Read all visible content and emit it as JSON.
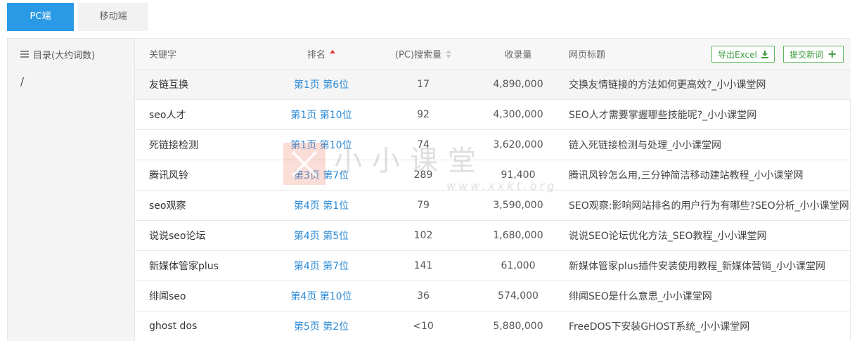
{
  "tabs": [
    {
      "label": "PC端",
      "active": true
    },
    {
      "label": "移动端",
      "active": false
    }
  ],
  "sidebar": {
    "title": "目录(大约词数)",
    "path": "/"
  },
  "table": {
    "headers": {
      "keyword": "关键字",
      "rank": "排名",
      "search_volume": "(PC)搜索量",
      "indexed": "收录量",
      "page_title": "网页标题"
    },
    "rank_sort": "ascending",
    "export_label": "导出Excel",
    "submit_label": "提交新词",
    "rows": [
      {
        "keyword": "友链互换",
        "rank": "第1页 第6位",
        "search": "17",
        "indexed": "4,890,000",
        "title": "交换友情链接的方法如何更高效?_小小课堂网"
      },
      {
        "keyword": "seo人才",
        "rank": "第1页 第10位",
        "search": "92",
        "indexed": "4,300,000",
        "title": "SEO人才需要掌握哪些技能呢?_小小课堂网"
      },
      {
        "keyword": "死链接检测",
        "rank": "第1页 第10位",
        "search": "74",
        "indexed": "3,620,000",
        "title": "链入死链接检测与处理_小小课堂网"
      },
      {
        "keyword": "腾讯风铃",
        "rank": "第3页 第7位",
        "search": "289",
        "indexed": "91,400",
        "title": "腾讯风铃怎么用,三分钟简洁移动建站教程_小小课堂网"
      },
      {
        "keyword": "seo观察",
        "rank": "第4页 第1位",
        "search": "79",
        "indexed": "3,590,000",
        "title": "SEO观察:影响网站排名的用户行为有哪些?SEO分析_小小课堂网"
      },
      {
        "keyword": "说说seo论坛",
        "rank": "第4页 第5位",
        "search": "102",
        "indexed": "1,680,000",
        "title": "说说SEO论坛优化方法_SEO教程_小小课堂网"
      },
      {
        "keyword": "新媒体管家plus",
        "rank": "第4页 第7位",
        "search": "141",
        "indexed": "61,000",
        "title": "新媒体管家plus插件安装使用教程_新媒体营销_小小课堂网"
      },
      {
        "keyword": "绯闻seo",
        "rank": "第4页 第10位",
        "search": "36",
        "indexed": "574,000",
        "title": "绯闻SEO是什么意思_小小课堂网"
      },
      {
        "keyword": "ghost dos",
        "rank": "第5页 第2位",
        "search": "<10",
        "indexed": "5,880,000",
        "title": "FreeDOS下安装GHOST系统_小小课堂网"
      }
    ]
  },
  "watermark": {
    "text": "小小课堂",
    "url": "www.xxkt.org"
  },
  "colors": {
    "accent": "#2b9ae6",
    "link": "#2b8ad6",
    "button_green": "#5cb85c",
    "sort_active": "#e0393e"
  }
}
